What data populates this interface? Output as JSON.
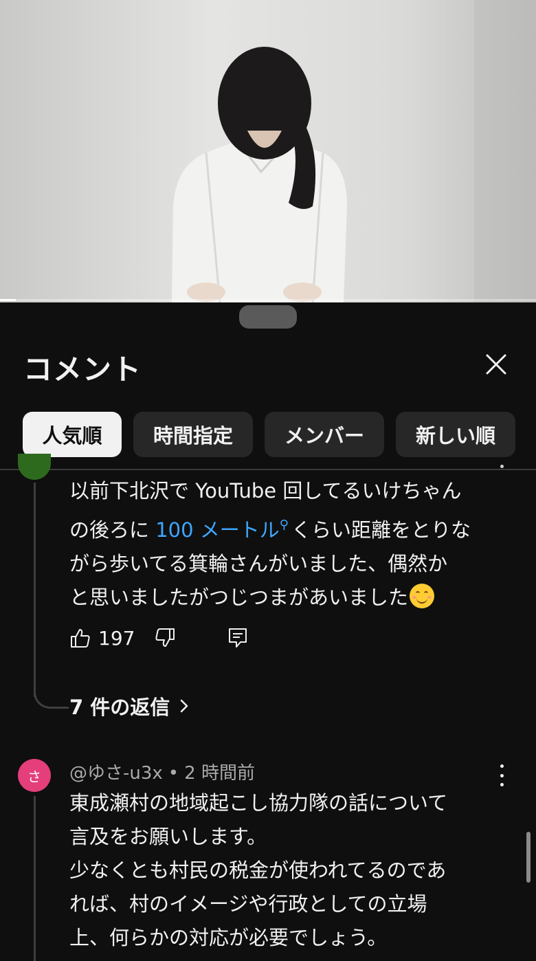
{
  "colors": {
    "background": "#0f0f0f",
    "chip_bg": "#272727",
    "chip_active_bg": "#f1f1f1",
    "link": "#3ea6ff",
    "avatar_pink": "#e43f7a",
    "avatar_green": "#2e6a1e"
  },
  "video": {
    "progress": 0.03
  },
  "comments_panel": {
    "title": "コメント",
    "close_icon": "close-icon",
    "sort_chips": [
      {
        "label": "人気順",
        "selected": true
      },
      {
        "label": "時間指定",
        "selected": false
      },
      {
        "label": "メンバー",
        "selected": false
      },
      {
        "label": "新しい順",
        "selected": false
      }
    ]
  },
  "comment1": {
    "line1": "以前下北沢で YouTube 回してるいけちゃん",
    "line2_before": "の後ろに ",
    "line2_link": "100 メートル",
    "line2_after": "くらい距離をとりな",
    "line3": "がら歩いてる箕輪さんがいました、偶然か",
    "line4": "と思いましたがつじつまがあいました",
    "emoji": "smiling-face-emoji",
    "likes": "197",
    "replies": "7 件の返信"
  },
  "comment2": {
    "avatar_letter": "さ",
    "author": "@ゆさ-u3x",
    "separator": "•",
    "time": "2 時間前",
    "lines": [
      "東成瀬村の地域起こし協力隊の話について",
      "言及をお願いします。",
      "少なくとも村民の税金が使われてるのであ",
      "れば、村のイメージや行政としての立場",
      "上、何らかの対応が必要でしょう。"
    ]
  }
}
